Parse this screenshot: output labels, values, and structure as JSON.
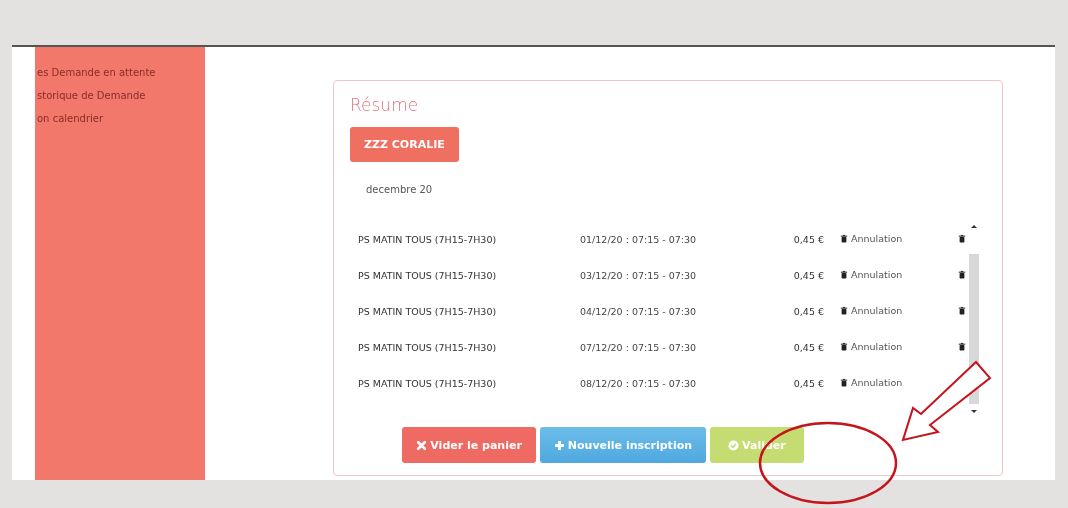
{
  "sidebar": {
    "items": [
      {
        "label": "es Demande en attente"
      },
      {
        "label": "storique de Demande"
      },
      {
        "label": "on calendrier"
      }
    ]
  },
  "summary": {
    "title": "Résume",
    "child_button": "ZZZ CORALIE",
    "month": "decembre 20",
    "rows": [
      {
        "activity": "PS MATIN TOUS (7H15-7H30)",
        "slot": "01/12/20 : 07:15 - 07:30",
        "price": "0,45 €",
        "cancel": "Annulation"
      },
      {
        "activity": "PS MATIN TOUS (7H15-7H30)",
        "slot": "03/12/20 : 07:15 - 07:30",
        "price": "0,45 €",
        "cancel": "Annulation"
      },
      {
        "activity": "PS MATIN TOUS (7H15-7H30)",
        "slot": "04/12/20 : 07:15 - 07:30",
        "price": "0,45 €",
        "cancel": "Annulation"
      },
      {
        "activity": "PS MATIN TOUS (7H15-7H30)",
        "slot": "07/12/20 : 07:15 - 07:30",
        "price": "0,45 €",
        "cancel": "Annulation"
      },
      {
        "activity": "PS MATIN TOUS (7H15-7H30)",
        "slot": "08/12/20 : 07:15 - 07:30",
        "price": "0,45 €",
        "cancel": "Annulation"
      }
    ],
    "buttons": [
      {
        "kind": "clear",
        "label": "Vider le panier"
      },
      {
        "kind": "add",
        "label": "Nouvelle inscription"
      },
      {
        "kind": "validate",
        "label": "Valider"
      }
    ]
  }
}
